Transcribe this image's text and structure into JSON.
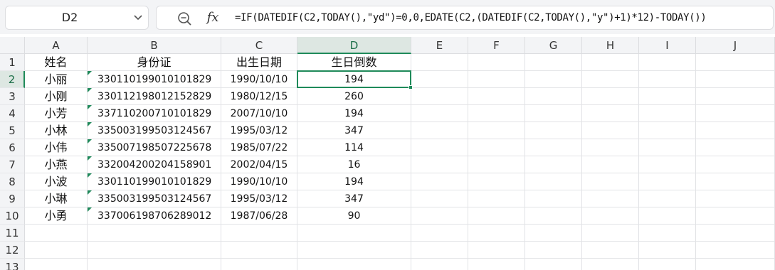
{
  "name_box": {
    "value": "D2"
  },
  "formula_bar": {
    "formula": "=IF(DATEDIF(C2,TODAY(),\"yd\")=0,0,EDATE(C2,(DATEDIF(C2,TODAY(),\"y\")+1)*12)-TODAY())"
  },
  "icons": {
    "zoom": "zoom-icon",
    "fx": "fx-icon",
    "dropdown": "chevron-down-icon"
  },
  "colors": {
    "accent": "#1f8a5a",
    "header_bg": "#f3f4f6"
  },
  "fx_label": "fx",
  "columns": [
    "A",
    "B",
    "C",
    "D",
    "E",
    "F",
    "G",
    "H",
    "I",
    "J"
  ],
  "active_column": "D",
  "row_numbers": [
    "1",
    "2",
    "3",
    "4",
    "5",
    "6",
    "7",
    "8",
    "9",
    "10",
    "11",
    "12",
    "13"
  ],
  "active_row": "2",
  "table": {
    "headers": [
      "姓名",
      "身份证",
      "出生日期",
      "生日倒数"
    ],
    "rows": [
      [
        "小丽",
        "330110199010101829",
        "1990/10/10",
        "194"
      ],
      [
        "小刚",
        "330112198012152829",
        "1980/12/15",
        "260"
      ],
      [
        "小芳",
        "337110200710101829",
        "2007/10/10",
        "194"
      ],
      [
        "小林",
        "335003199503124567",
        "1995/03/12",
        "347"
      ],
      [
        "小伟",
        "335007198507225678",
        "1985/07/22",
        "114"
      ],
      [
        "小燕",
        "332004200204158901",
        "2002/04/15",
        "16"
      ],
      [
        "小波",
        "330110199010101829",
        "1990/10/10",
        "194"
      ],
      [
        "小琳",
        "335003199503124567",
        "1995/03/12",
        "347"
      ],
      [
        "小勇",
        "337006198706289012",
        "1987/06/28",
        "90"
      ]
    ]
  },
  "selected_cell": "D2"
}
